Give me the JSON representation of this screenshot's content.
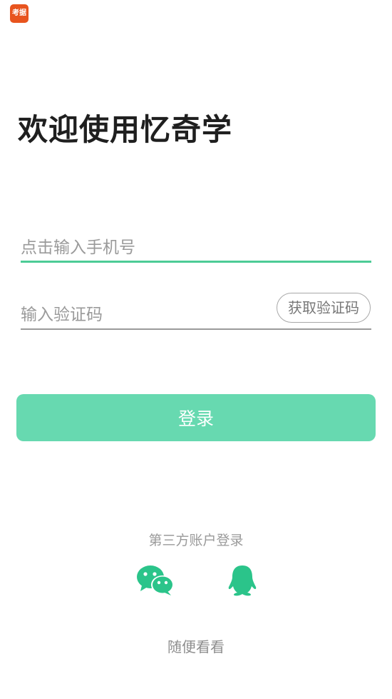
{
  "app_icon": {
    "text": "考据",
    "color": "#e8541e"
  },
  "header": {
    "title": "欢迎使用忆奇学"
  },
  "form": {
    "phone_placeholder": "点击输入手机号",
    "phone_value": "",
    "code_placeholder": "输入验证码",
    "code_value": "",
    "get_code_label": "获取验证码",
    "login_label": "登录"
  },
  "third_party": {
    "label": "第三方账户登录",
    "providers": [
      {
        "icon": "wechat-icon"
      },
      {
        "icon": "qq-icon"
      }
    ]
  },
  "browse_label": "随便看看",
  "colors": {
    "accent": "#4ccb96",
    "button": "#67d9b0",
    "muted": "#9a9a9a"
  }
}
